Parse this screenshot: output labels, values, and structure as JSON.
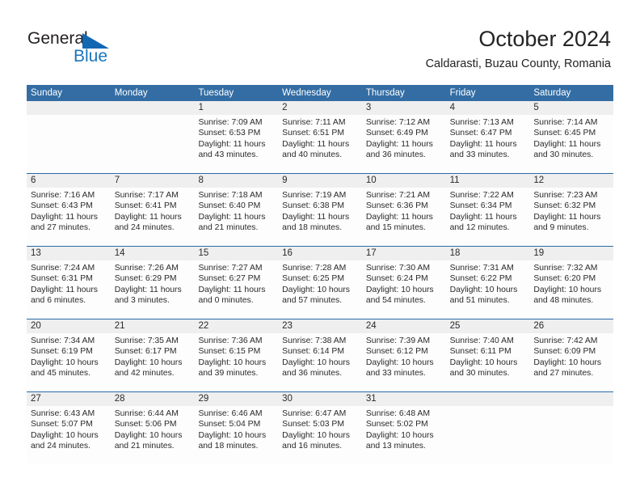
{
  "logo": {
    "word1": "General",
    "word2": "Blue",
    "triangle_color": "#1267b2",
    "word2_color": "#1b75bb"
  },
  "header": {
    "title": "October 2024",
    "subtitle": "Caldarasti, Buzau County, Romania"
  },
  "theme": {
    "header_bar": "#336da4",
    "row_divider": "#2b6ca8",
    "daynum_band": "#efefef",
    "cell_bg": "#fdfdfd",
    "text": "#2a2a2a"
  },
  "weekdays": [
    "Sunday",
    "Monday",
    "Tuesday",
    "Wednesday",
    "Thursday",
    "Friday",
    "Saturday"
  ],
  "weeks": [
    [
      {
        "day": "",
        "empty": true
      },
      {
        "day": "",
        "empty": true
      },
      {
        "day": "1",
        "sunrise": "Sunrise: 7:09 AM",
        "sunset": "Sunset: 6:53 PM",
        "daylight1": "Daylight: 11 hours",
        "daylight2": "and 43 minutes."
      },
      {
        "day": "2",
        "sunrise": "Sunrise: 7:11 AM",
        "sunset": "Sunset: 6:51 PM",
        "daylight1": "Daylight: 11 hours",
        "daylight2": "and 40 minutes."
      },
      {
        "day": "3",
        "sunrise": "Sunrise: 7:12 AM",
        "sunset": "Sunset: 6:49 PM",
        "daylight1": "Daylight: 11 hours",
        "daylight2": "and 36 minutes."
      },
      {
        "day": "4",
        "sunrise": "Sunrise: 7:13 AM",
        "sunset": "Sunset: 6:47 PM",
        "daylight1": "Daylight: 11 hours",
        "daylight2": "and 33 minutes."
      },
      {
        "day": "5",
        "sunrise": "Sunrise: 7:14 AM",
        "sunset": "Sunset: 6:45 PM",
        "daylight1": "Daylight: 11 hours",
        "daylight2": "and 30 minutes."
      }
    ],
    [
      {
        "day": "6",
        "sunrise": "Sunrise: 7:16 AM",
        "sunset": "Sunset: 6:43 PM",
        "daylight1": "Daylight: 11 hours",
        "daylight2": "and 27 minutes."
      },
      {
        "day": "7",
        "sunrise": "Sunrise: 7:17 AM",
        "sunset": "Sunset: 6:41 PM",
        "daylight1": "Daylight: 11 hours",
        "daylight2": "and 24 minutes."
      },
      {
        "day": "8",
        "sunrise": "Sunrise: 7:18 AM",
        "sunset": "Sunset: 6:40 PM",
        "daylight1": "Daylight: 11 hours",
        "daylight2": "and 21 minutes."
      },
      {
        "day": "9",
        "sunrise": "Sunrise: 7:19 AM",
        "sunset": "Sunset: 6:38 PM",
        "daylight1": "Daylight: 11 hours",
        "daylight2": "and 18 minutes."
      },
      {
        "day": "10",
        "sunrise": "Sunrise: 7:21 AM",
        "sunset": "Sunset: 6:36 PM",
        "daylight1": "Daylight: 11 hours",
        "daylight2": "and 15 minutes."
      },
      {
        "day": "11",
        "sunrise": "Sunrise: 7:22 AM",
        "sunset": "Sunset: 6:34 PM",
        "daylight1": "Daylight: 11 hours",
        "daylight2": "and 12 minutes."
      },
      {
        "day": "12",
        "sunrise": "Sunrise: 7:23 AM",
        "sunset": "Sunset: 6:32 PM",
        "daylight1": "Daylight: 11 hours",
        "daylight2": "and 9 minutes."
      }
    ],
    [
      {
        "day": "13",
        "sunrise": "Sunrise: 7:24 AM",
        "sunset": "Sunset: 6:31 PM",
        "daylight1": "Daylight: 11 hours",
        "daylight2": "and 6 minutes."
      },
      {
        "day": "14",
        "sunrise": "Sunrise: 7:26 AM",
        "sunset": "Sunset: 6:29 PM",
        "daylight1": "Daylight: 11 hours",
        "daylight2": "and 3 minutes."
      },
      {
        "day": "15",
        "sunrise": "Sunrise: 7:27 AM",
        "sunset": "Sunset: 6:27 PM",
        "daylight1": "Daylight: 11 hours",
        "daylight2": "and 0 minutes."
      },
      {
        "day": "16",
        "sunrise": "Sunrise: 7:28 AM",
        "sunset": "Sunset: 6:25 PM",
        "daylight1": "Daylight: 10 hours",
        "daylight2": "and 57 minutes."
      },
      {
        "day": "17",
        "sunrise": "Sunrise: 7:30 AM",
        "sunset": "Sunset: 6:24 PM",
        "daylight1": "Daylight: 10 hours",
        "daylight2": "and 54 minutes."
      },
      {
        "day": "18",
        "sunrise": "Sunrise: 7:31 AM",
        "sunset": "Sunset: 6:22 PM",
        "daylight1": "Daylight: 10 hours",
        "daylight2": "and 51 minutes."
      },
      {
        "day": "19",
        "sunrise": "Sunrise: 7:32 AM",
        "sunset": "Sunset: 6:20 PM",
        "daylight1": "Daylight: 10 hours",
        "daylight2": "and 48 minutes."
      }
    ],
    [
      {
        "day": "20",
        "sunrise": "Sunrise: 7:34 AM",
        "sunset": "Sunset: 6:19 PM",
        "daylight1": "Daylight: 10 hours",
        "daylight2": "and 45 minutes."
      },
      {
        "day": "21",
        "sunrise": "Sunrise: 7:35 AM",
        "sunset": "Sunset: 6:17 PM",
        "daylight1": "Daylight: 10 hours",
        "daylight2": "and 42 minutes."
      },
      {
        "day": "22",
        "sunrise": "Sunrise: 7:36 AM",
        "sunset": "Sunset: 6:15 PM",
        "daylight1": "Daylight: 10 hours",
        "daylight2": "and 39 minutes."
      },
      {
        "day": "23",
        "sunrise": "Sunrise: 7:38 AM",
        "sunset": "Sunset: 6:14 PM",
        "daylight1": "Daylight: 10 hours",
        "daylight2": "and 36 minutes."
      },
      {
        "day": "24",
        "sunrise": "Sunrise: 7:39 AM",
        "sunset": "Sunset: 6:12 PM",
        "daylight1": "Daylight: 10 hours",
        "daylight2": "and 33 minutes."
      },
      {
        "day": "25",
        "sunrise": "Sunrise: 7:40 AM",
        "sunset": "Sunset: 6:11 PM",
        "daylight1": "Daylight: 10 hours",
        "daylight2": "and 30 minutes."
      },
      {
        "day": "26",
        "sunrise": "Sunrise: 7:42 AM",
        "sunset": "Sunset: 6:09 PM",
        "daylight1": "Daylight: 10 hours",
        "daylight2": "and 27 minutes."
      }
    ],
    [
      {
        "day": "27",
        "sunrise": "Sunrise: 6:43 AM",
        "sunset": "Sunset: 5:07 PM",
        "daylight1": "Daylight: 10 hours",
        "daylight2": "and 24 minutes."
      },
      {
        "day": "28",
        "sunrise": "Sunrise: 6:44 AM",
        "sunset": "Sunset: 5:06 PM",
        "daylight1": "Daylight: 10 hours",
        "daylight2": "and 21 minutes."
      },
      {
        "day": "29",
        "sunrise": "Sunrise: 6:46 AM",
        "sunset": "Sunset: 5:04 PM",
        "daylight1": "Daylight: 10 hours",
        "daylight2": "and 18 minutes."
      },
      {
        "day": "30",
        "sunrise": "Sunrise: 6:47 AM",
        "sunset": "Sunset: 5:03 PM",
        "daylight1": "Daylight: 10 hours",
        "daylight2": "and 16 minutes."
      },
      {
        "day": "31",
        "sunrise": "Sunrise: 6:48 AM",
        "sunset": "Sunset: 5:02 PM",
        "daylight1": "Daylight: 10 hours",
        "daylight2": "and 13 minutes."
      },
      {
        "day": "",
        "empty": true
      },
      {
        "day": "",
        "empty": true
      }
    ]
  ]
}
